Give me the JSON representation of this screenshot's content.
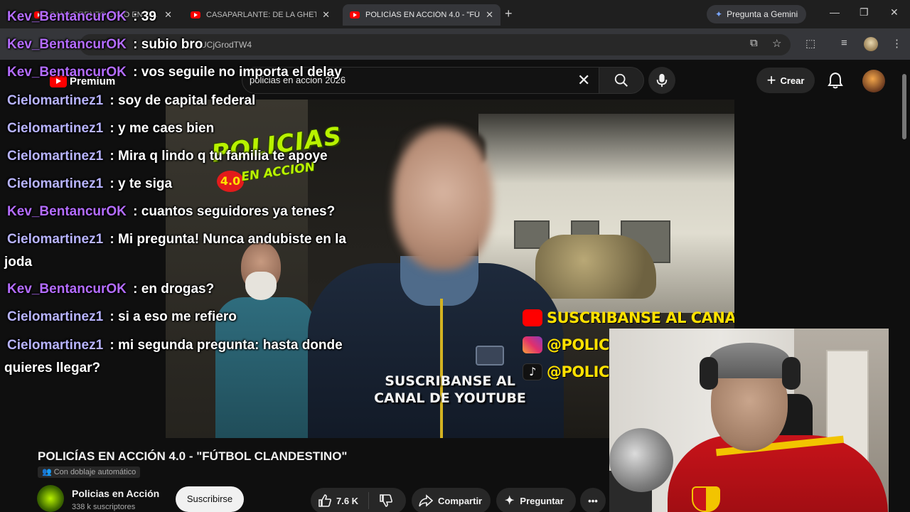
{
  "colors": {
    "kev": "#b46cff",
    "cielo": "#b8b4ff",
    "chrome_bg": "#1f1f1f",
    "youtube_red": "#ff0000",
    "overlay_yellow": "#ffe100"
  },
  "browser": {
    "tabs": [
      {
        "title": "SAN LORENZO CAYÓ EN SU...",
        "active": false
      },
      {
        "title": "CASAPARLANTE: DE LA GHETTO...",
        "active": false
      },
      {
        "title": "POLICÍAS EN ACCIÓN 4.0 - \"FÚ...",
        "active": true
      }
    ],
    "gemini_label": "Pregunta a Gemini",
    "address": "UCjGrodTW4"
  },
  "youtube": {
    "logo_label": "Premium",
    "search_value": "policias en accion 2026",
    "create_label": "Crear"
  },
  "video": {
    "overlay_logo_line1": "POLICIAS",
    "overlay_logo_num": "4.0",
    "overlay_logo_line2": "EN ACCION",
    "social_youtube": "SUSCRIBANSE AL CANAL",
    "social_instagram": "@POLICIAS",
    "social_tiktok": "@POLICIAS",
    "subtitle": "SUSCRIBANSE AL CANAL DE YOUTUBE"
  },
  "info": {
    "title": "POLICÍAS EN ACCIÓN 4.0 - \"FÚTBOL CLANDESTINO\"",
    "dub_badge": "Con doblaje automático",
    "channel_name": "Policias en Acción",
    "channel_subs": "338 k suscriptores",
    "subscribe_label": "Suscribirse",
    "likes": "7.6 K",
    "share_label": "Compartir",
    "ask_label": "Preguntar"
  },
  "chat": [
    {
      "user": "Kev_BentancurOK",
      "text": ": 39"
    },
    {
      "user": "Kev_BentancurOK",
      "text": ": subio bro"
    },
    {
      "user": "Kev_BentancurOK",
      "text": ": vos seguile no importa el delay"
    },
    {
      "user": "Cielomartinez1",
      "text": ": soy de capital federal"
    },
    {
      "user": "Cielomartinez1",
      "text": ": y me caes bien"
    },
    {
      "user": "Cielomartinez1",
      "text": ": Mira q lindo q tu familia te apoye"
    },
    {
      "user": "Cielomartinez1",
      "text": ": y te siga"
    },
    {
      "user": "Kev_BentancurOK",
      "text": ": cuantos seguidores ya tenes?"
    },
    {
      "user": "Cielomartinez1",
      "text": ": Mi pregunta! Nunca andubiste en la joda"
    },
    {
      "user": "Kev_BentancurOK",
      "text": ": en drogas?"
    },
    {
      "user": "Cielomartinez1",
      "text": ": si a eso me refiero"
    },
    {
      "user": "Cielomartinez1",
      "text": ": mi segunda pregunta: hasta donde quieres llegar?"
    }
  ]
}
